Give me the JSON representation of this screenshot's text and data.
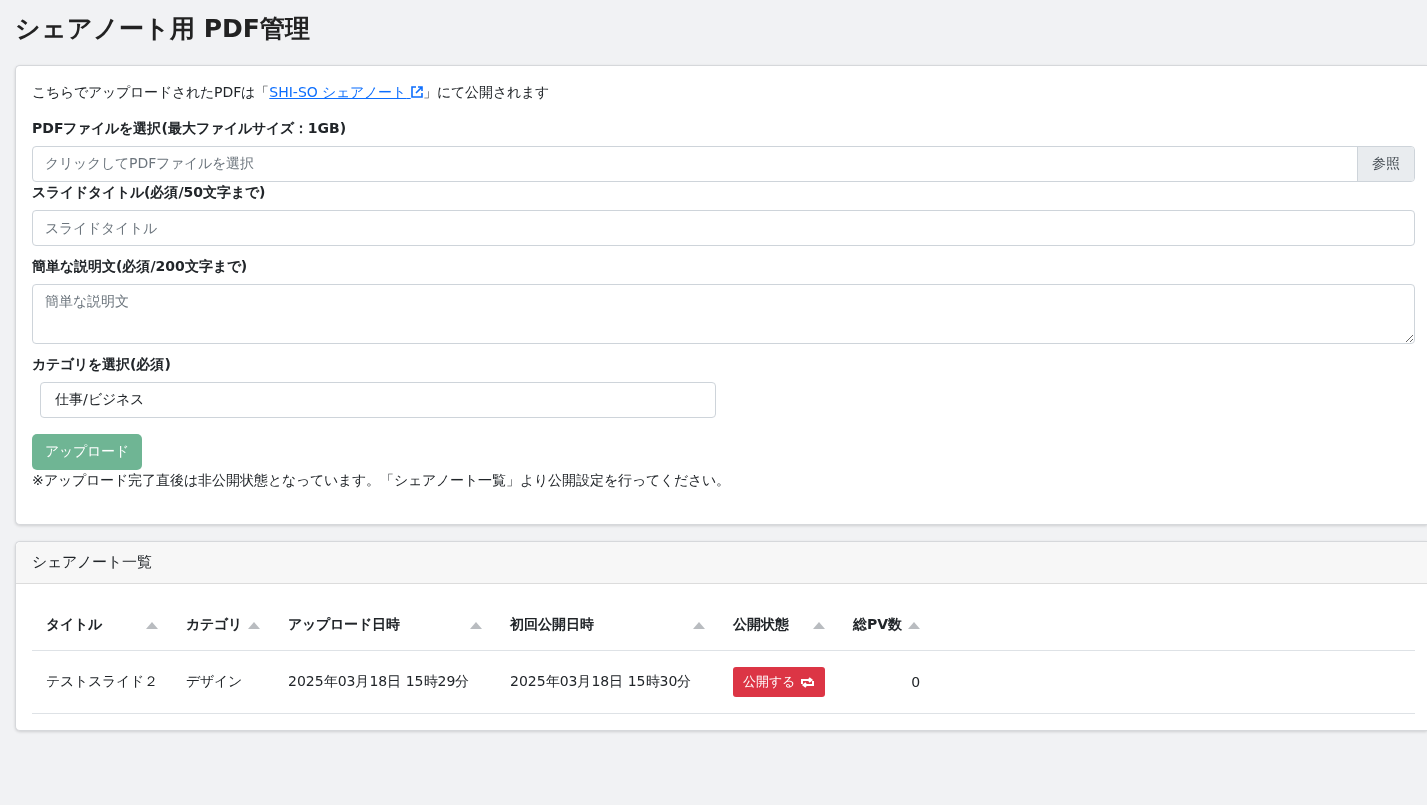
{
  "page_title": "シェアノート用 PDF管理",
  "upload_form": {
    "intro": {
      "before": "こちらでアップロードされたPDFは「",
      "link": "SHI-SO シェアノート",
      "after": "」にて公開されます"
    },
    "fields": [
      {
        "kind": "file",
        "label": "PDFファイルを選択(最大ファイルサイズ：1GB)",
        "placeholder": "クリックしてPDFファイルを選択",
        "button": "参照"
      },
      {
        "kind": "text",
        "label": "スライドタイトル(必須/50文字まで)",
        "placeholder": "スライドタイトル"
      },
      {
        "kind": "textarea",
        "label": "簡単な説明文(必須/200文字まで)",
        "placeholder": "簡単な説明文"
      },
      {
        "kind": "select",
        "label": "カテゴリを選択(必須)",
        "value": "仕事/ビジネス"
      }
    ],
    "upload_button": {
      "label": "アップロード",
      "disabled": true
    },
    "note": "※アップロード完了直後は非公開状態となっています。「シェアノート一覧」より公開設定を行ってください。"
  },
  "note_list": {
    "title": "シェアノート一覧",
    "columns": [
      "タイトル",
      "カテゴリ",
      "アップロード日時",
      "初回公開日時",
      "公開状態",
      "総PV数"
    ],
    "rows": [
      {
        "title": "テストスライド２",
        "category": "デザイン",
        "uploaded": "2025年03月18日 15時29分",
        "first_published": "2025年03月18日 15時30分",
        "publish_button": "公開する",
        "total_pv": "0"
      }
    ]
  }
}
